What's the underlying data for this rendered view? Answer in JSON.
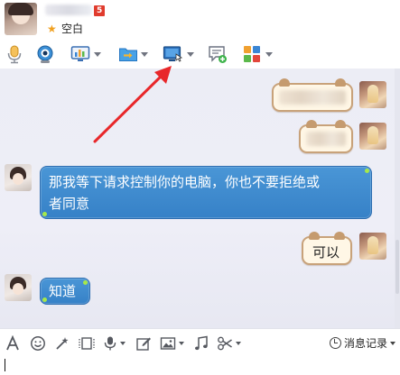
{
  "header": {
    "status_icon": "star-icon",
    "status_text": "空白",
    "vip_badge": "5",
    "badge_color": "#e03b2d"
  },
  "toolbar": {
    "icons": [
      "microphone-icon",
      "video-camera-icon",
      "chart-screen-icon",
      "send-file-icon",
      "remote-desktop-icon",
      "add-message-icon",
      "apps-grid-icon"
    ]
  },
  "messages": [
    {
      "side": "right",
      "style": "cream",
      "text": "",
      "redacted": true
    },
    {
      "side": "right",
      "style": "cream",
      "text": "",
      "redacted": true
    },
    {
      "side": "left",
      "style": "blue",
      "lines": [
        "那我等下请求控制你的电脑，你也不要拒绝或",
        "者同意"
      ]
    },
    {
      "side": "right",
      "style": "cream",
      "text": "可以"
    },
    {
      "side": "left",
      "style": "blue",
      "lines": [
        "知道"
      ]
    }
  ],
  "annotation": {
    "type": "arrow",
    "color": "#e8272a"
  },
  "input_toolbar": {
    "icons": [
      "font-icon",
      "emoji-icon",
      "magic-wand-icon",
      "gif-icon",
      "voice-icon",
      "screenshot-icon",
      "image-icon",
      "music-icon",
      "scissors-icon"
    ],
    "history_label": "消息记录"
  },
  "colors": {
    "chat_bg": "#ecedf5",
    "bubble_blue": "#3681c7",
    "bubble_cream": "#fff7e6"
  }
}
